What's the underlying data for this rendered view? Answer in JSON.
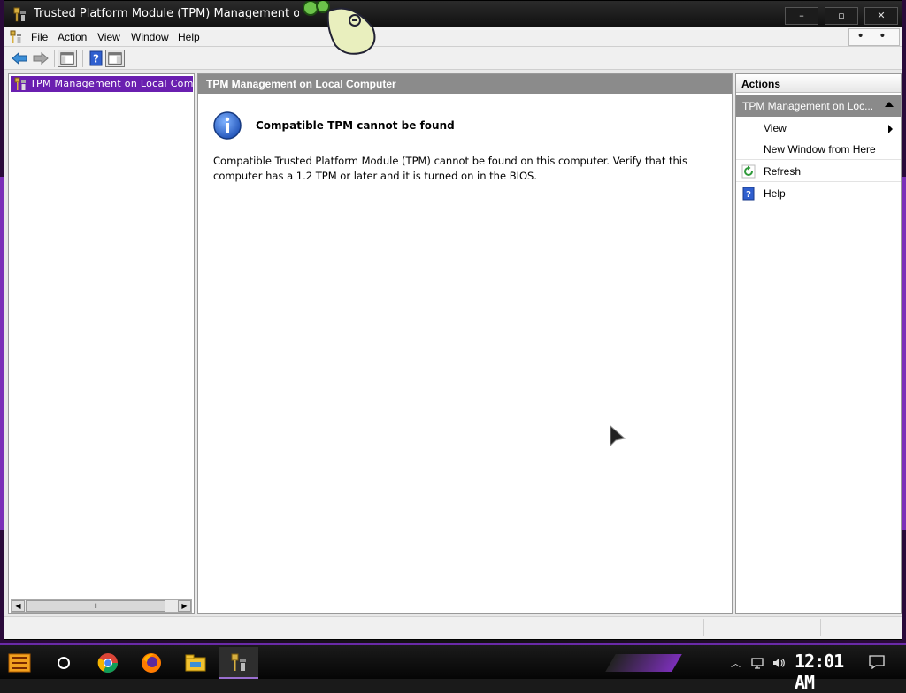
{
  "window": {
    "title": "Trusted Platform Module (TPM) Management on Loc",
    "controls": {
      "minimize": "–",
      "maximize": "▫",
      "close": "✕"
    }
  },
  "menu": {
    "items": [
      "File",
      "Action",
      "View",
      "Window",
      "Help"
    ],
    "overflow": "• • •"
  },
  "toolbar": {
    "icons": [
      "back-arrow-icon",
      "forward-arrow-icon",
      "show-hide-tree-icon",
      "help-icon",
      "show-hide-action-pane-icon"
    ]
  },
  "tree": {
    "selected_label": "TPM Management on Local Computer"
  },
  "main": {
    "header": "TPM Management on Local Computer",
    "message_title": "Compatible TPM cannot be found",
    "message_body": "Compatible Trusted Platform Module (TPM) cannot be found on this computer. Verify that this computer has a 1.2 TPM or later and it is turned on in the BIOS."
  },
  "actions": {
    "title": "Actions",
    "section": "TPM Management on Loc...",
    "items": [
      {
        "label": "View",
        "icon": "",
        "submenu": true
      },
      {
        "label": "New Window from Here",
        "icon": "",
        "submenu": false
      },
      {
        "label": "Refresh",
        "icon": "refresh-icon",
        "submenu": false
      },
      {
        "label": "Help",
        "icon": "help-icon",
        "submenu": false
      }
    ]
  },
  "taskbar": {
    "clock": "12:01 AM",
    "apps": [
      "start-icon",
      "cortana-icon",
      "chrome-icon",
      "firefox-icon",
      "file-explorer-icon",
      "tpm-icon"
    ]
  },
  "colors": {
    "accent_purple": "#6a1fb0",
    "header_gray": "#8b8b8b",
    "titlebar": "#101010"
  }
}
